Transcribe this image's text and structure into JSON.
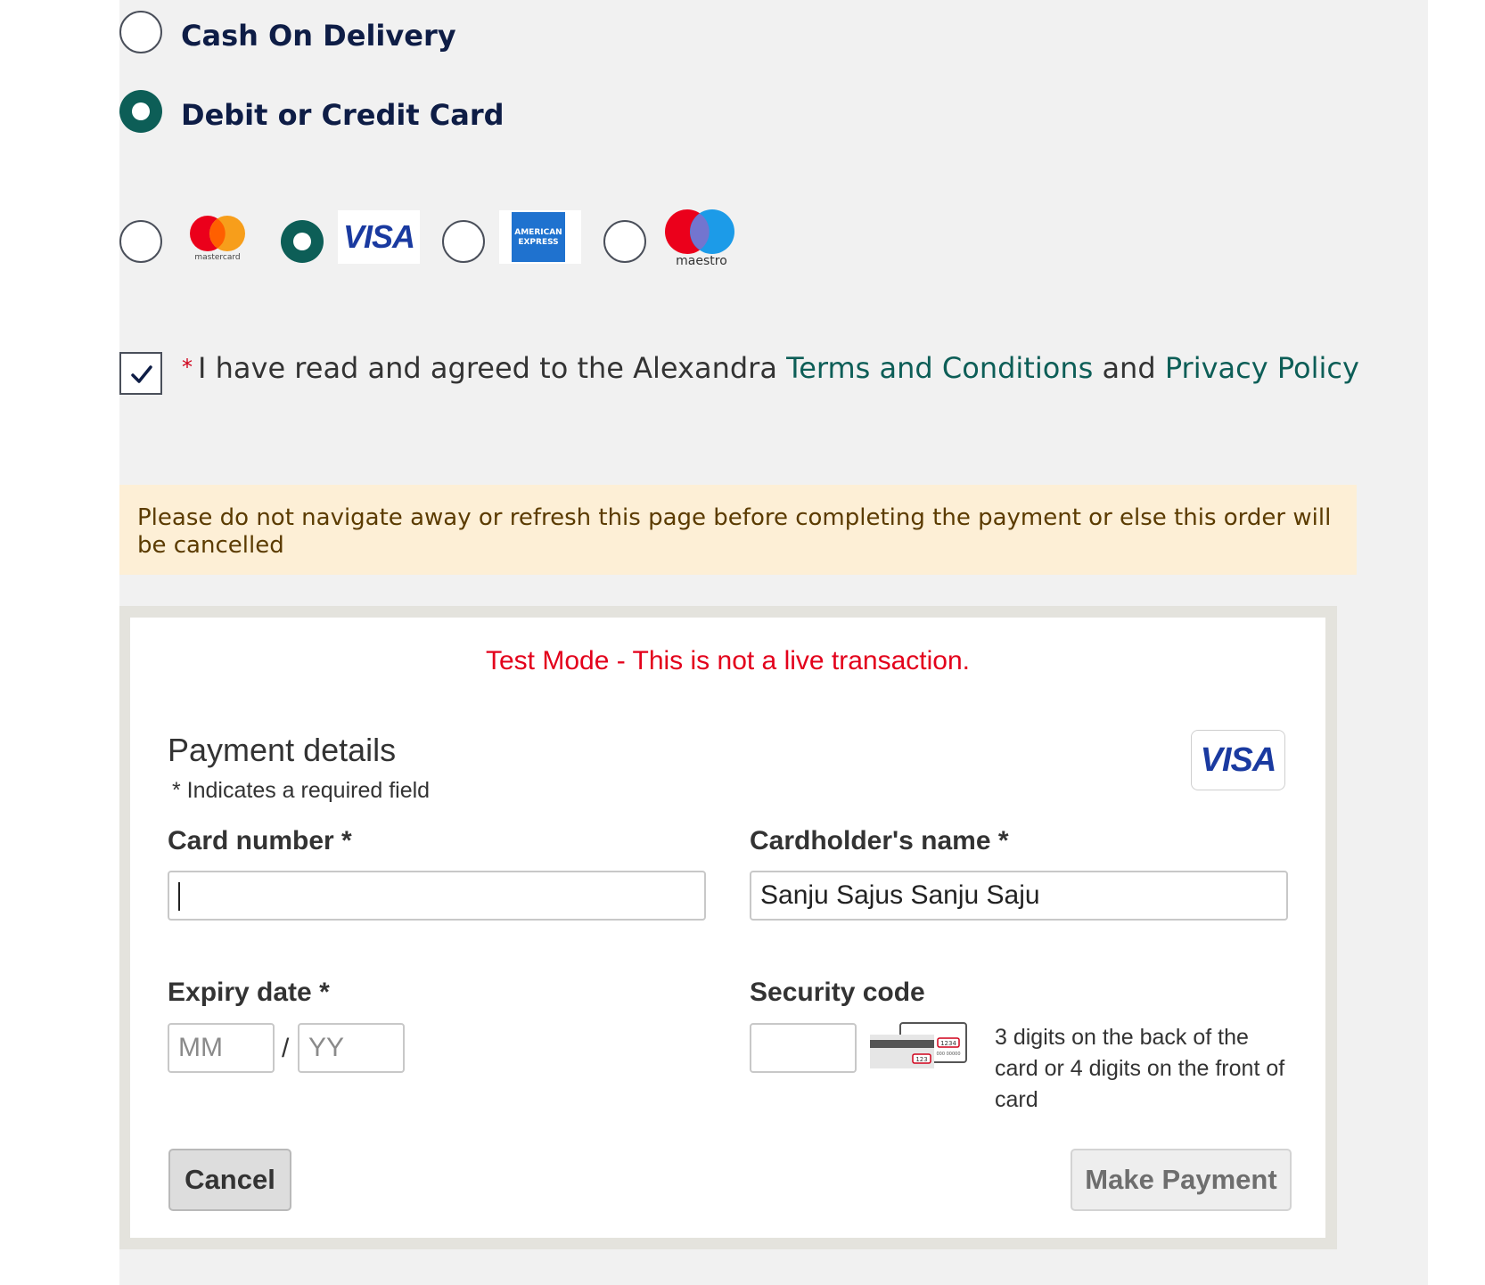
{
  "payment_methods": {
    "cash_on_delivery": "Cash On Delivery",
    "card": "Debit or Credit Card",
    "selected": "Debit or Credit Card"
  },
  "card_brands": {
    "mastercard": "mastercard",
    "visa": "VISA",
    "amex": "AMERICAN EXPRESS",
    "maestro": "maestro",
    "selected": "VISA"
  },
  "terms": {
    "checked": true,
    "required_marker": "*",
    "prefix": "I have read and agreed to the Alexandra",
    "terms_link": "Terms and Conditions",
    "joiner": "and",
    "privacy_link": "Privacy Policy"
  },
  "notice": {
    "text": "Please do not navigate away or refresh this page before completing the payment or else this order will be cancelled"
  },
  "card_form": {
    "test_mode": "Test Mode - This is not a live transaction.",
    "title": "Payment details",
    "required_hint": "* Indicates a required field",
    "badge": "VISA",
    "card_number_label": "Card number *",
    "card_number_value": "",
    "cardholder_label": "Cardholder's name *",
    "cardholder_value": "Sanju Sajus Sanju Saju",
    "expiry_label": "Expiry date *",
    "expiry_month_placeholder": "MM",
    "expiry_separator": "/",
    "expiry_year_placeholder": "YY",
    "security_label": "Security code",
    "security_help": "3 digits on the back of the card or 4 digits on the front of card",
    "security_card_back_code": "123",
    "security_card_front_code": "1234",
    "security_card_front_number": "000 00000",
    "cancel_label": "Cancel",
    "pay_label": "Make Payment"
  },
  "colors": {
    "accent": "#0d5e57",
    "heading_navy": "#0e1d46",
    "error_red": "#e3001b",
    "notice_bg": "#fdefd6",
    "panel_bg": "#f1f1f1"
  }
}
